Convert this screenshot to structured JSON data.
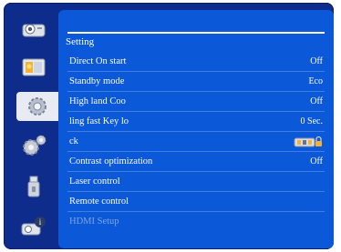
{
  "menu": {
    "title": "Setting",
    "rows": [
      {
        "label": "Direct On start",
        "value": "Off",
        "disabled": false
      },
      {
        "label": "Standby mode",
        "value": "Eco",
        "disabled": false
      },
      {
        "label": "High land  Coo",
        "value": "Off",
        "disabled": false
      },
      {
        "label": "ling fast  Key lo",
        "value": "0 Sec.",
        "disabled": false
      },
      {
        "label": "ck",
        "value": "",
        "value_icon": "keypad-lock-icon",
        "disabled": false
      },
      {
        "label": "Contrast optimization",
        "value": "Off",
        "disabled": false
      },
      {
        "label": "Laser control",
        "value": "",
        "disabled": false
      },
      {
        "label": "Remote control",
        "value": "",
        "disabled": false
      },
      {
        "label": "HDMI Setup",
        "value": "",
        "disabled": true
      }
    ]
  },
  "sidebar": {
    "items": [
      {
        "icon": "projector-icon",
        "active": false
      },
      {
        "icon": "picture-adjust-icon",
        "active": false
      },
      {
        "icon": "gear-setting-icon",
        "active": true
      },
      {
        "icon": "advanced-gears-icon",
        "active": false
      },
      {
        "icon": "usb-drive-icon",
        "active": false
      },
      {
        "icon": "information-icon",
        "active": false
      }
    ]
  },
  "colors": {
    "frame": "#0e2c8c",
    "panel": "#0b58d8",
    "text": "#ffffff",
    "disabled_text": "#7ea3e6"
  }
}
